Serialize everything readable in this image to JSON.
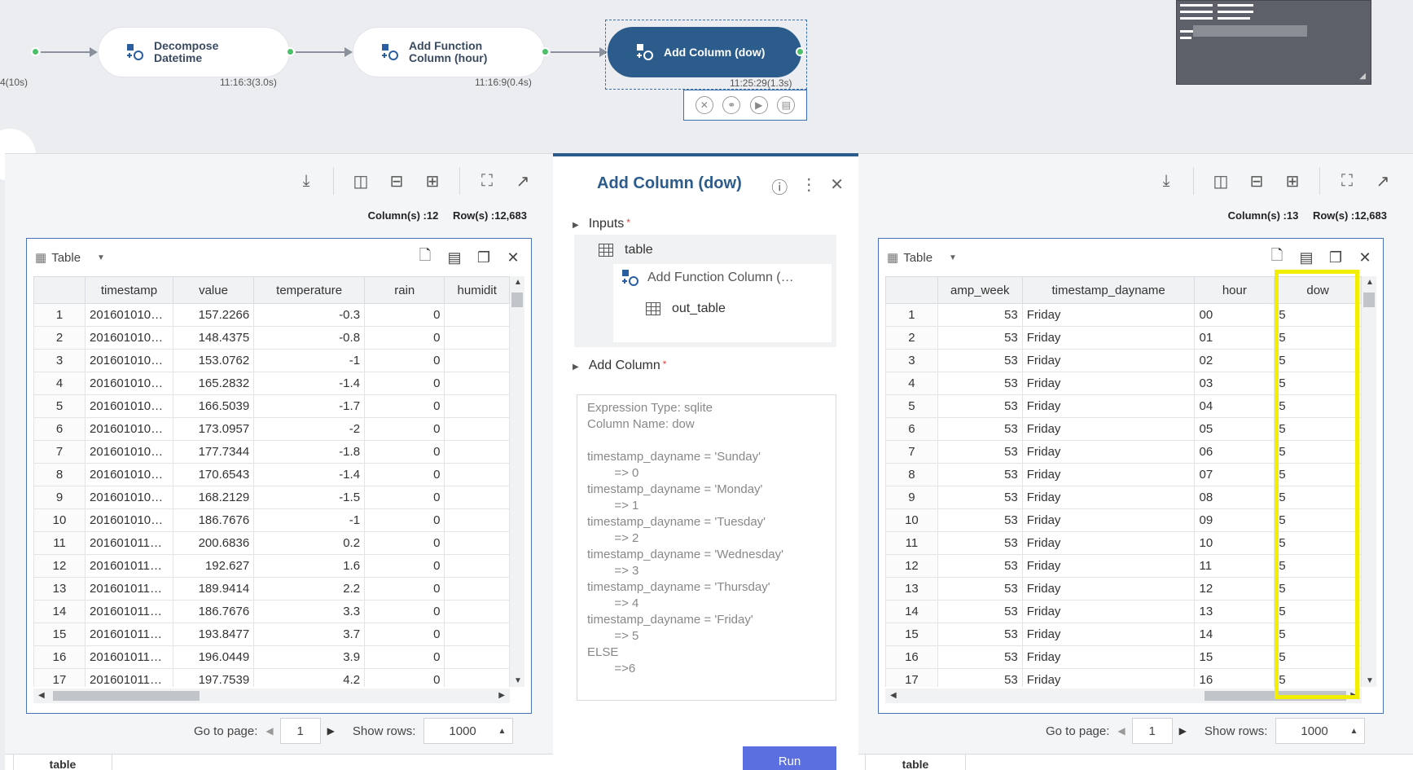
{
  "flow": {
    "prev_time": "4(10s)",
    "nodes": [
      {
        "label_line1": "Decompose",
        "label_line2": "Datetime",
        "time": "11:16:3(3.0s)"
      },
      {
        "label_line1": "Add Function",
        "label_line2": "Column (hour)",
        "time": "11:16:9(0.4s)"
      },
      {
        "label_line1": "Add Column (dow)",
        "label_line2": "",
        "time": "11:25:29(1.3s)"
      }
    ],
    "node_tools": [
      "cancel-icon",
      "share-icon",
      "play-icon",
      "clipboard-icon"
    ]
  },
  "left": {
    "meta_cols": "Column(s) :12",
    "meta_rows": "Row(s) :12,683",
    "table_label": "Table",
    "columns": [
      "",
      "timestamp",
      "value",
      "temperature",
      "rain",
      "humidit"
    ],
    "rows": [
      [
        "1",
        "201601010…",
        "157.2266",
        "-0.3",
        "0"
      ],
      [
        "2",
        "201601010…",
        "148.4375",
        "-0.8",
        "0"
      ],
      [
        "3",
        "201601010…",
        "153.0762",
        "-1",
        "0"
      ],
      [
        "4",
        "201601010…",
        "165.2832",
        "-1.4",
        "0"
      ],
      [
        "5",
        "201601010…",
        "166.5039",
        "-1.7",
        "0"
      ],
      [
        "6",
        "201601010…",
        "173.0957",
        "-2",
        "0"
      ],
      [
        "7",
        "201601010…",
        "177.7344",
        "-1.8",
        "0"
      ],
      [
        "8",
        "201601010…",
        "170.6543",
        "-1.4",
        "0"
      ],
      [
        "9",
        "201601010…",
        "168.2129",
        "-1.5",
        "0"
      ],
      [
        "10",
        "201601010…",
        "186.7676",
        "-1",
        "0"
      ],
      [
        "11",
        "201601011…",
        "200.6836",
        "0.2",
        "0"
      ],
      [
        "12",
        "201601011…",
        "192.627",
        "1.6",
        "0"
      ],
      [
        "13",
        "201601011…",
        "189.9414",
        "2.2",
        "0"
      ],
      [
        "14",
        "201601011…",
        "186.7676",
        "3.3",
        "0"
      ],
      [
        "15",
        "201601011…",
        "193.8477",
        "3.7",
        "0"
      ],
      [
        "16",
        "201601011…",
        "196.0449",
        "3.9",
        "0"
      ],
      [
        "17",
        "201601011…",
        "197.7539",
        "4.2",
        "0"
      ]
    ],
    "pager": {
      "go_label": "Go to page:",
      "page": "1",
      "rows_label": "Show rows:",
      "rows": "1000"
    },
    "bottom_tab": "table"
  },
  "config": {
    "title": "Add Column (dow)",
    "inputs_label": "Inputs",
    "input_table": "table",
    "input_source": "Add Function Column (…",
    "input_out": "out_table",
    "addcol_label": "Add Column",
    "expression": "Expression Type: sqlite\nColumn Name: dow\n\ntimestamp_dayname = 'Sunday'\n        => 0\ntimestamp_dayname = 'Monday'\n        => 1\ntimestamp_dayname = 'Tuesday'\n        => 2\ntimestamp_dayname = 'Wednesday'\n        => 3\ntimestamp_dayname = 'Thursday'\n        => 4\ntimestamp_dayname = 'Friday'\n        => 5\nELSE\n        =>6",
    "run_label": "Run"
  },
  "right": {
    "meta_cols": "Column(s) :13",
    "meta_rows": "Row(s) :12,683",
    "table_label": "Table",
    "columns": [
      "",
      "amp_week",
      "timestamp_dayname",
      "hour",
      "dow"
    ],
    "rows": [
      [
        "1",
        "53",
        "Friday",
        "00",
        "5"
      ],
      [
        "2",
        "53",
        "Friday",
        "01",
        "5"
      ],
      [
        "3",
        "53",
        "Friday",
        "02",
        "5"
      ],
      [
        "4",
        "53",
        "Friday",
        "03",
        "5"
      ],
      [
        "5",
        "53",
        "Friday",
        "04",
        "5"
      ],
      [
        "6",
        "53",
        "Friday",
        "05",
        "5"
      ],
      [
        "7",
        "53",
        "Friday",
        "06",
        "5"
      ],
      [
        "8",
        "53",
        "Friday",
        "07",
        "5"
      ],
      [
        "9",
        "53",
        "Friday",
        "08",
        "5"
      ],
      [
        "10",
        "53",
        "Friday",
        "09",
        "5"
      ],
      [
        "11",
        "53",
        "Friday",
        "10",
        "5"
      ],
      [
        "12",
        "53",
        "Friday",
        "11",
        "5"
      ],
      [
        "13",
        "53",
        "Friday",
        "12",
        "5"
      ],
      [
        "14",
        "53",
        "Friday",
        "13",
        "5"
      ],
      [
        "15",
        "53",
        "Friday",
        "14",
        "5"
      ],
      [
        "16",
        "53",
        "Friday",
        "15",
        "5"
      ],
      [
        "17",
        "53",
        "Friday",
        "16",
        "5"
      ]
    ],
    "pager": {
      "go_label": "Go to page:",
      "page": "1",
      "rows_label": "Show rows:",
      "rows": "1000"
    },
    "bottom_tab": "table"
  },
  "colors": {
    "accent": "#2b5c8c",
    "run": "#5b6fe0",
    "highlight": "#f2ee00",
    "port": "#4cbf6a"
  }
}
